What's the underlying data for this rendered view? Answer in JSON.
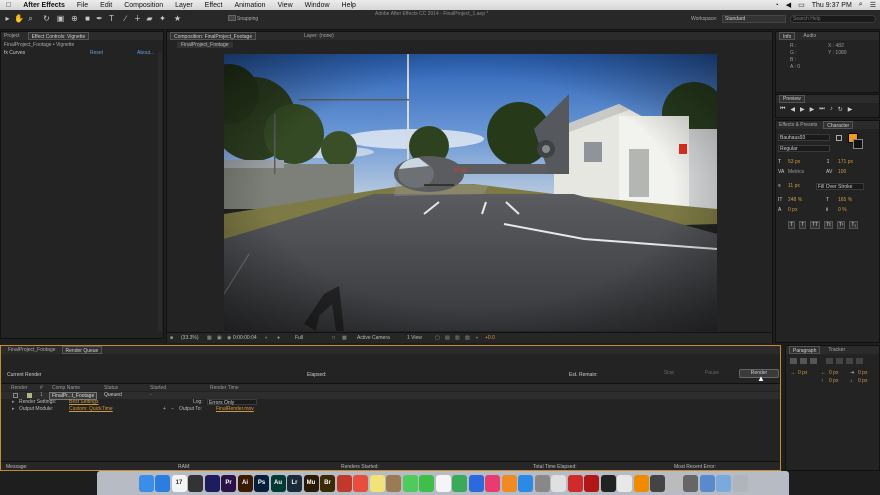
{
  "menubar": {
    "apple": "",
    "items": [
      "After Effects",
      "File",
      "Edit",
      "Composition",
      "Layer",
      "Effect",
      "Animation",
      "View",
      "Window",
      "Help"
    ],
    "clock": "Thu 9:37 PM"
  },
  "toolbar": {
    "window_title": "Adobe After Effects CC 2014 - FinalProject_1.aep *",
    "snapping": "Snapping",
    "workspace_label": "Workspace:",
    "workspace_value": "Standard",
    "search_placeholder": "Search Help"
  },
  "project_panel": {
    "tabs": [
      "Project",
      "Effect Controls: Vignette"
    ],
    "breadcrumb": "FinalProject_Footage • Vignette",
    "effect_name": "fx Curves",
    "reset": "Reset",
    "about": "About..."
  },
  "composition": {
    "tab": "Composition: FinalProject_Footage",
    "layer_tab": "Layer: (none)",
    "sub_tab": "FinalProject_Footage",
    "zoom": "(33.3%)",
    "timecode": "0:00:00:04",
    "resolution": "Full",
    "camera": "Active Camera",
    "views": "1 View",
    "offset": "+0.0"
  },
  "info_panel": {
    "tabs": [
      "Info",
      "Audio"
    ],
    "r": "R :",
    "g": "G :",
    "b": "B :",
    "a": "A : 0",
    "x": "X : 482",
    "y": "Y : 1080"
  },
  "preview_panel": {
    "title": "Preview"
  },
  "character_panel": {
    "tabs": [
      "Effects & Presets",
      "Character"
    ],
    "font": "Bauhaus93",
    "style": "Regular",
    "size": "53 px",
    "leading": "171 px",
    "kerning": "Metrics",
    "tracking": "100",
    "stroke": "11 px",
    "stroke_mode": "Fill Over Stroke",
    "vscale": "248 %",
    "hscale": "165 %",
    "baseline": "0 px",
    "tsume": "0 %",
    "fill_color": "#f39a1e"
  },
  "bottom_tabs": [
    "FinalProject_Footage",
    "Render Queue"
  ],
  "render_queue": {
    "current_render": "Current Render",
    "elapsed": "Elapsed:",
    "est_remain": "Est. Remain:",
    "stop": "Stop",
    "pause": "Pause",
    "render": "Render",
    "columns": [
      "Render",
      "#",
      "Comp Name",
      "Status",
      "Started",
      "Render Time"
    ],
    "item": {
      "number": "1",
      "comp": "FinalPr...t_Footage",
      "status": "Queued",
      "started": "-",
      "render_settings_label": "Render Settings:",
      "render_settings_value": "Best Settings",
      "log_label": "Log:",
      "log_value": "Errors Only",
      "output_module_label": "Output Module:",
      "output_module_value": "Custom: QuickTime",
      "output_to_label": "Output To:",
      "output_to_value": "FinalRender.mov"
    },
    "status_bar": {
      "message": "Message:",
      "ram": "RAM:",
      "renders_started": "Renders Started:",
      "total_time": "Total Time Elapsed:",
      "recent_error": "Most Recent Error:"
    }
  },
  "paragraph_panel": {
    "tabs": [
      "Paragraph",
      "Tracker"
    ],
    "indent_values": [
      "0 px",
      "0 px",
      "0 px",
      "0 px",
      "0 px"
    ]
  },
  "dock": {
    "apps": [
      {
        "name": "finder",
        "label": "",
        "color": "#3a8ee6"
      },
      {
        "name": "safari",
        "label": "",
        "color": "#2b7de0"
      },
      {
        "name": "calendar",
        "label": "17",
        "color": "#f4f4f4"
      },
      {
        "name": "clapper",
        "label": "",
        "color": "#333"
      },
      {
        "name": "media-encoder",
        "label": "",
        "color": "#1d1d5e"
      },
      {
        "name": "premiere",
        "label": "Pr",
        "color": "#2a1146"
      },
      {
        "name": "illustrator",
        "label": "Ai",
        "color": "#3b1a03"
      },
      {
        "name": "photoshop",
        "label": "Ps",
        "color": "#061e3a"
      },
      {
        "name": "audition",
        "label": "Au",
        "color": "#003a33"
      },
      {
        "name": "lightroom",
        "label": "Lr",
        "color": "#1a2a3a"
      },
      {
        "name": "muse",
        "label": "Mu",
        "color": "#2a1a05"
      },
      {
        "name": "bridge",
        "label": "Br",
        "color": "#3a2a05"
      },
      {
        "name": "after-effects",
        "label": "",
        "color": "#c0392b"
      },
      {
        "name": "app-a",
        "label": "",
        "color": "#e84e3c"
      },
      {
        "name": "notes",
        "label": "",
        "color": "#f2e27a"
      },
      {
        "name": "contacts",
        "label": "",
        "color": "#9a7b56"
      },
      {
        "name": "messages",
        "label": "",
        "color": "#4ecb5c"
      },
      {
        "name": "facetime",
        "label": "",
        "color": "#3fbf4a"
      },
      {
        "name": "photos",
        "label": "",
        "color": "#f5f5f5"
      },
      {
        "name": "numbers",
        "label": "",
        "color": "#3aaa5a"
      },
      {
        "name": "keynote",
        "label": "",
        "color": "#2a6adc"
      },
      {
        "name": "itunes",
        "label": "",
        "color": "#e83b6f"
      },
      {
        "name": "ibooks",
        "label": "",
        "color": "#f08a24"
      },
      {
        "name": "app-store",
        "label": "",
        "color": "#2a8ae6"
      },
      {
        "name": "system-prefs",
        "label": "",
        "color": "#888"
      },
      {
        "name": "app-circle",
        "label": "",
        "color": "#e0e0e0"
      },
      {
        "name": "app-red",
        "label": "",
        "color": "#d02a2a"
      },
      {
        "name": "filezilla",
        "label": "",
        "color": "#b01818"
      },
      {
        "name": "terminal",
        "label": "",
        "color": "#222"
      },
      {
        "name": "chrome",
        "label": "",
        "color": "#e8e8e8"
      },
      {
        "name": "vlc",
        "label": "",
        "color": "#f08a00"
      },
      {
        "name": "app-dark",
        "label": "",
        "color": "#444"
      },
      {
        "name": "app-gray",
        "label": "",
        "color": "#bbb"
      },
      {
        "name": "app-small",
        "label": "",
        "color": "#666"
      },
      {
        "name": "downloads",
        "label": "",
        "color": "#5a8acc"
      },
      {
        "name": "documents",
        "label": "",
        "color": "#7aaadd"
      },
      {
        "name": "trash",
        "label": "",
        "color": "#b0b4bb"
      }
    ]
  }
}
